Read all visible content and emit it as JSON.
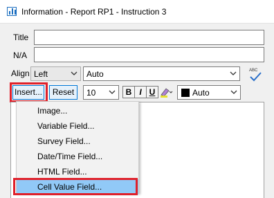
{
  "window": {
    "title": "Information - Report RP1 - Instruction 3"
  },
  "form": {
    "title_label": "Title",
    "title_value": "",
    "na_label": "N/A",
    "na_value": "",
    "align_label": "Align",
    "align_value": "Left",
    "valign_value": "Auto",
    "spell_icon_text": "ABC"
  },
  "toolbar": {
    "insert_label": "Insert...",
    "reset_label": "Reset",
    "font_size_value": "10",
    "bold_label": "B",
    "italic_label": "I",
    "underline_label": "U",
    "color_value": "Auto",
    "color_swatch": "#000000"
  },
  "insert_menu": {
    "items": [
      {
        "label": "Image..."
      },
      {
        "label": "Variable Field..."
      },
      {
        "label": "Survey Field..."
      },
      {
        "label": "Date/Time Field..."
      },
      {
        "label": "HTML Field..."
      },
      {
        "label": "Cell Value Field..."
      }
    ],
    "highlighted_item": "Cell Value Field..."
  },
  "colors": {
    "highlight_box": "#e0202a",
    "menu_highlight": "#91c9f7",
    "focus_border": "#0078d7"
  }
}
